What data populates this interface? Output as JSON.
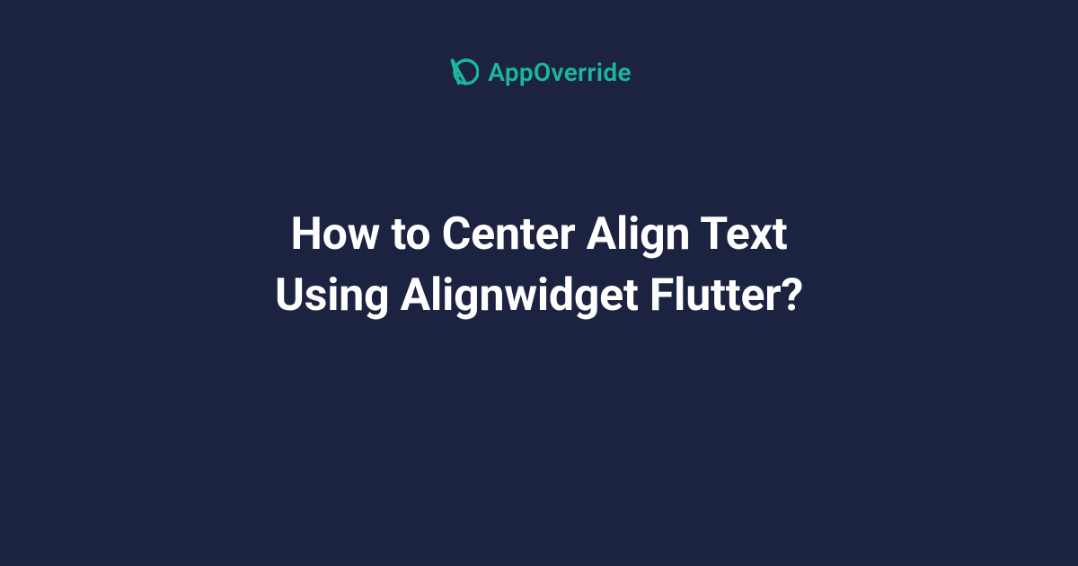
{
  "brand": {
    "name": "AppOverride",
    "accent_color": "#1ab89b"
  },
  "heading": {
    "line1": "How to Center Align Text",
    "line2": "Using Alignwidget Flutter?"
  },
  "colors": {
    "background": "#1b2341",
    "text": "#ffffff"
  }
}
